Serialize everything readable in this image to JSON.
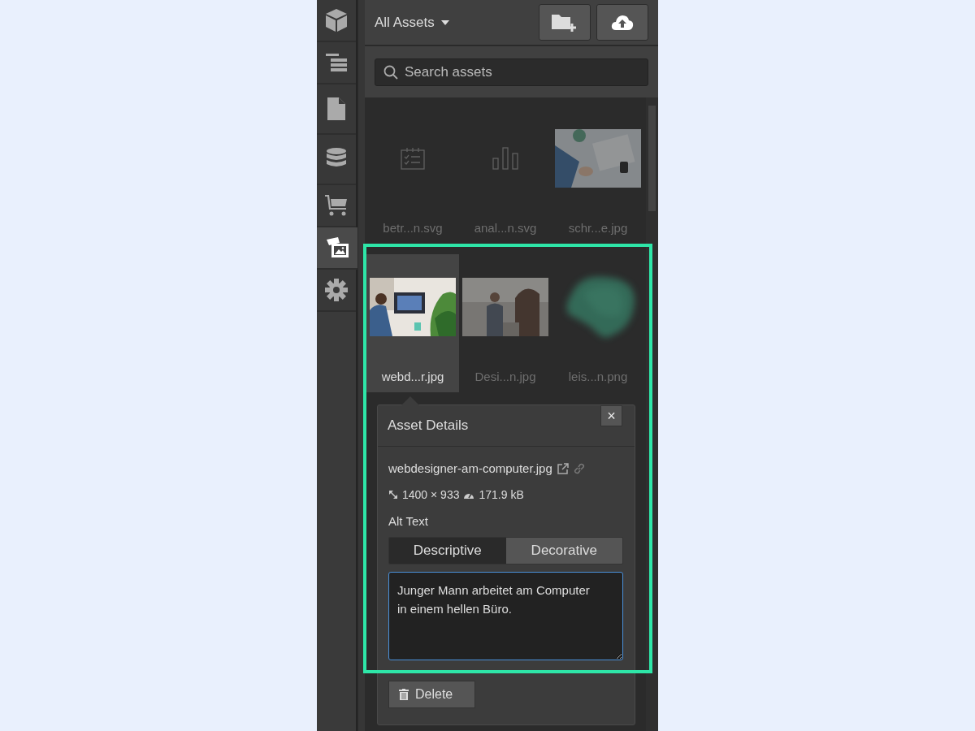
{
  "sidebar": {
    "items": [
      {
        "kind": "cube",
        "selected": false
      },
      {
        "kind": "layers",
        "selected": false
      },
      {
        "kind": "page",
        "selected": false
      },
      {
        "kind": "database",
        "selected": false
      },
      {
        "kind": "cart",
        "selected": false
      },
      {
        "kind": "assets",
        "selected": true
      },
      {
        "kind": "gear",
        "selected": false
      }
    ]
  },
  "header": {
    "title": "All Assets"
  },
  "search": {
    "placeholder": "Search assets"
  },
  "assets": [
    {
      "name": "betr...n.svg",
      "kind": "checklist",
      "selected": false
    },
    {
      "name": "anal...n.svg",
      "kind": "chart",
      "selected": false
    },
    {
      "name": "schr...e.jpg",
      "selected": false
    },
    {
      "name": "webd...r.jpg",
      "selected": true
    },
    {
      "name": "Desi...n.jpg",
      "selected": false
    },
    {
      "name": "leis...n.png",
      "kind": "blob",
      "selected": false
    }
  ],
  "details": {
    "title": "Asset Details",
    "close": "×",
    "filename": "webdesigner-am-computer.jpg",
    "dimensions": "1400 × 933",
    "size": "171.9 kB",
    "alt_label": "Alt Text",
    "alt_modes": [
      {
        "label": "Descriptive",
        "selected": true
      },
      {
        "label": "Decorative",
        "selected": false
      }
    ],
    "alt_text": "Junger Mann arbeitet am Computer in einem hellen Büro.",
    "delete": "Delete"
  }
}
